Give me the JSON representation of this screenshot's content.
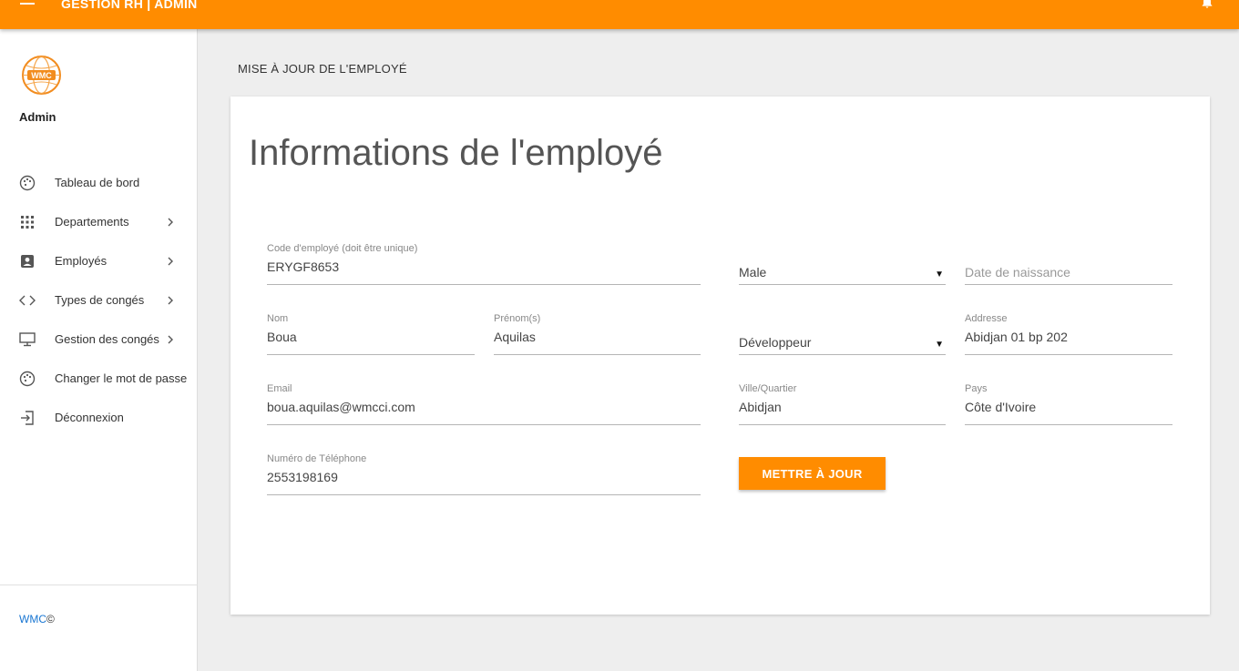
{
  "header": {
    "title": "GESTION RH | ADMIN",
    "menu_icon": "hamburger-menu-icon",
    "notification_icon": "bell-icon"
  },
  "sidebar": {
    "user_name": "Admin",
    "logo_text": "WMC",
    "items": [
      {
        "label": "Tableau de bord",
        "icon": "palette-icon",
        "has_submenu": false
      },
      {
        "label": "Departements",
        "icon": "grid-icon",
        "has_submenu": true
      },
      {
        "label": "Employés",
        "icon": "account-box-icon",
        "has_submenu": true
      },
      {
        "label": "Types de congés",
        "icon": "code-icon",
        "has_submenu": true
      },
      {
        "label": "Gestion des congés",
        "icon": "desktop-icon",
        "has_submenu": true
      },
      {
        "label": "Changer le mot de passe",
        "icon": "palette-icon",
        "has_submenu": false
      },
      {
        "label": "Déconnexion",
        "icon": "logout-icon",
        "has_submenu": false
      }
    ],
    "footer": {
      "brand": "WMC",
      "symbol": "©"
    }
  },
  "main": {
    "page_heading": "MISE À JOUR DE L'EMPLOYÉ",
    "card_title": "Informations de l'employé",
    "fields": {
      "employee_code": {
        "label": "Code d'employé (doit être unique)",
        "value": "ERYGF8653"
      },
      "gender": {
        "value": "Male"
      },
      "birth_date": {
        "placeholder": "Date de naissance"
      },
      "last_name": {
        "label": "Nom",
        "value": "Boua"
      },
      "first_name": {
        "label": "Prénom(s)",
        "value": "Aquilas"
      },
      "department": {
        "value": "Développeur"
      },
      "address": {
        "label": "Addresse",
        "value": "Abidjan 01 bp 202"
      },
      "email": {
        "label": "Email",
        "value": "boua.aquilas@wmcci.com"
      },
      "city": {
        "label": "Ville/Quartier",
        "value": "Abidjan"
      },
      "country": {
        "label": "Pays",
        "value": "Côte d'Ivoire"
      },
      "phone": {
        "label": "Numéro de Téléphone",
        "value": "2553198169"
      }
    },
    "update_button": "METTRE À JOUR"
  },
  "colors": {
    "accent": "#ff8c00",
    "background": "#eeeeee",
    "link": "#1976d2"
  }
}
